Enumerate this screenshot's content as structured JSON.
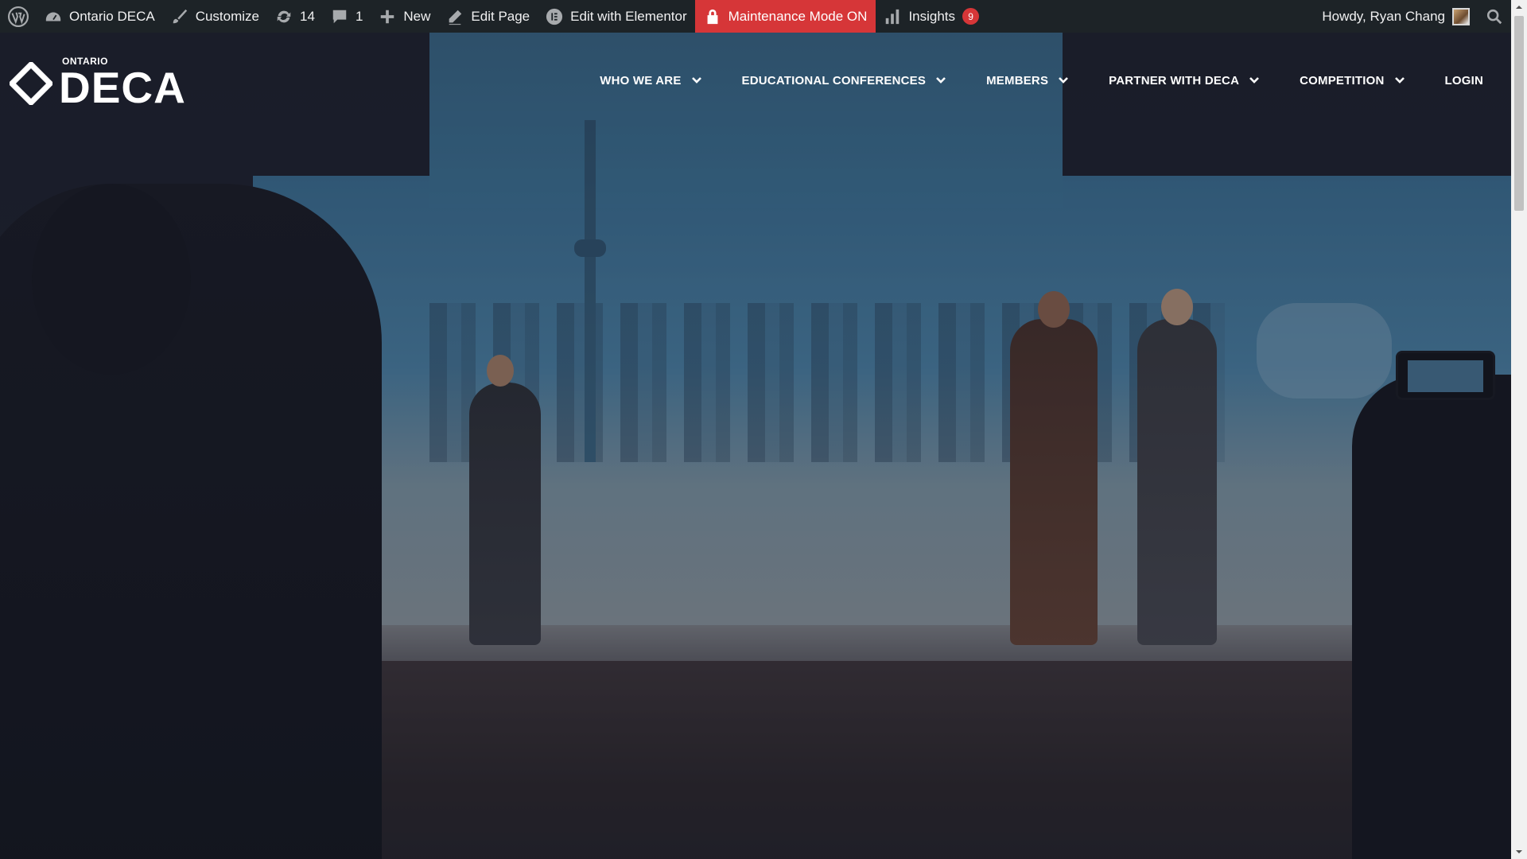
{
  "adminbar": {
    "site_name": "Ontario DECA",
    "customize": "Customize",
    "updates_count": "14",
    "comments_count": "1",
    "new_label": "New",
    "edit_page": "Edit Page",
    "edit_elementor": "Edit with Elementor",
    "maintenance": "Maintenance Mode ON",
    "insights": "Insights",
    "insights_badge": "9",
    "howdy": "Howdy, Ryan Chang",
    "colors": {
      "bar": "#1d2327",
      "maintenance": "#d63638",
      "badge": "#d63638"
    }
  },
  "logo": {
    "small": "ONTARIO",
    "big": "DECA"
  },
  "nav": {
    "items": [
      {
        "label": "WHO WE ARE",
        "dropdown": true
      },
      {
        "label": "EDUCATIONAL CONFERENCES",
        "dropdown": true
      },
      {
        "label": "MEMBERS",
        "dropdown": true
      },
      {
        "label": "PARTNER WITH DECA",
        "dropdown": true
      },
      {
        "label": "COMPETITION",
        "dropdown": true
      },
      {
        "label": "LOGIN",
        "dropdown": false
      }
    ]
  },
  "icons": [
    "wordpress-icon",
    "dashboard-icon",
    "brush-icon",
    "updates-icon",
    "comment-icon",
    "plus-icon",
    "pencil-icon",
    "elementor-icon",
    "lock-icon",
    "chart-icon",
    "search-icon",
    "chevron-down-icon"
  ]
}
